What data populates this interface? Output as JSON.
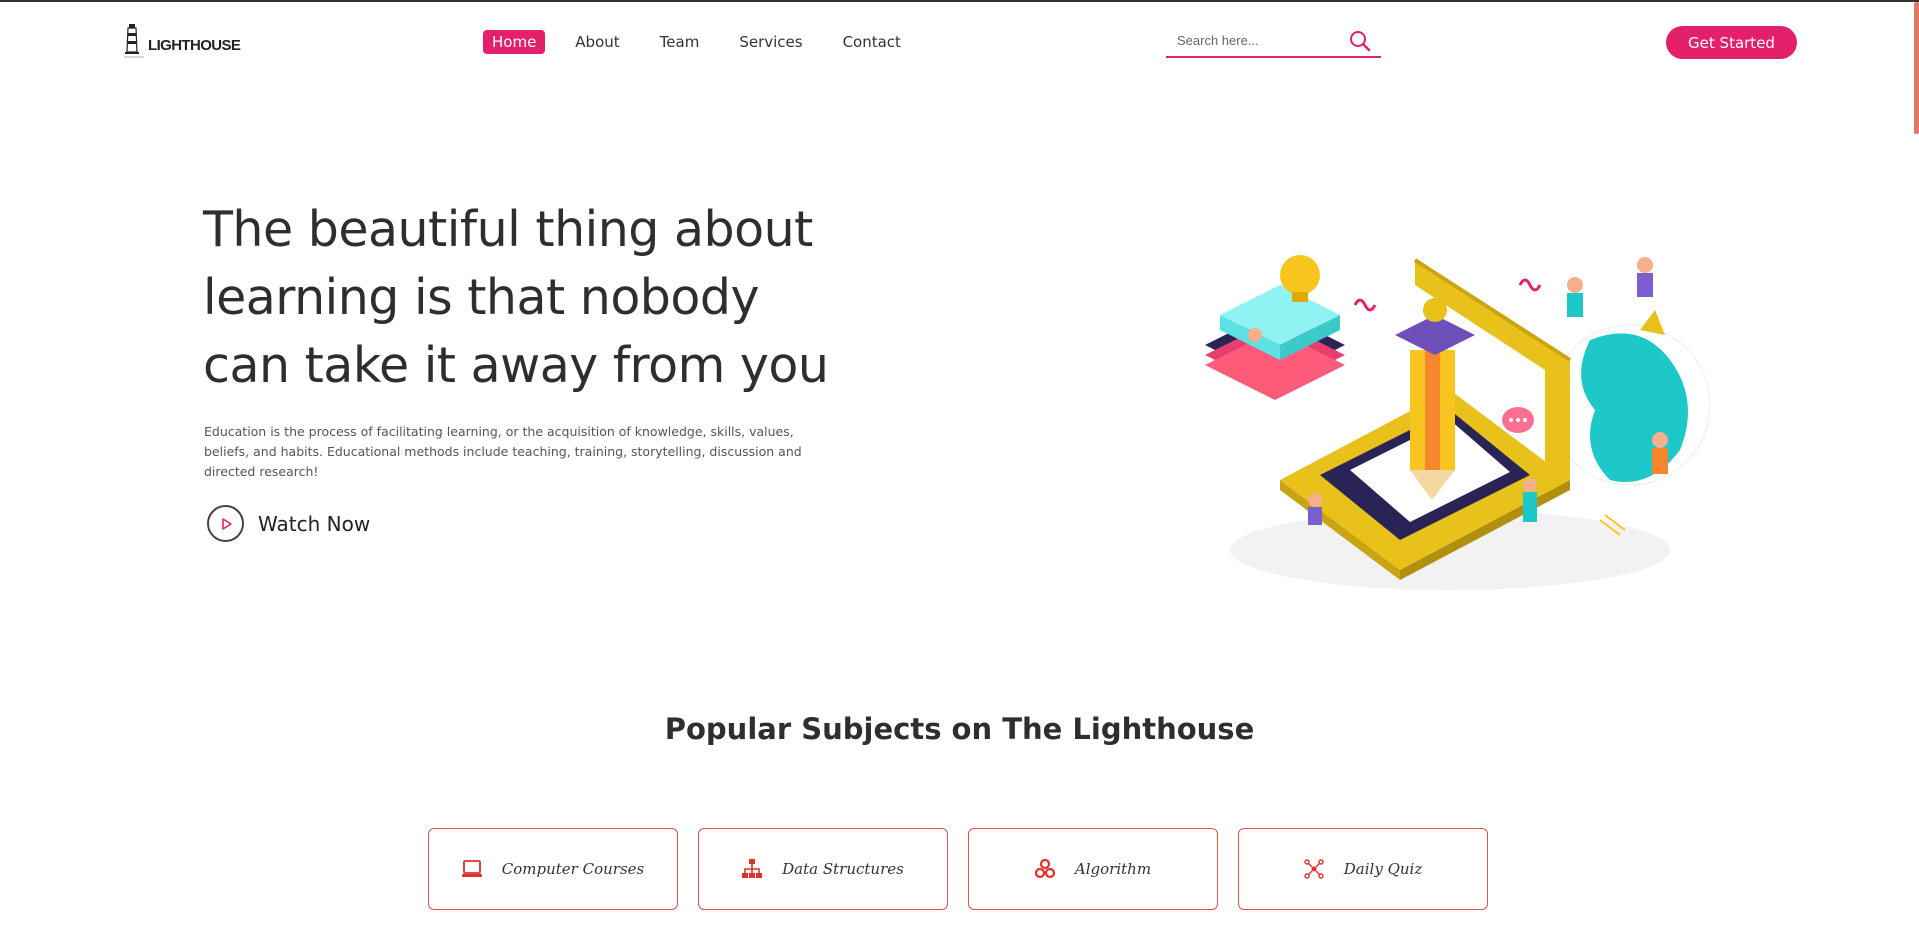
{
  "header": {
    "logo_text": "LIGHTHOUSE",
    "nav": [
      {
        "label": "Home",
        "active": true
      },
      {
        "label": "About",
        "active": false
      },
      {
        "label": "Team",
        "active": false
      },
      {
        "label": "Services",
        "active": false
      },
      {
        "label": "Contact",
        "active": false
      }
    ],
    "search_placeholder": "Search here...",
    "cta_label": "Get Started"
  },
  "hero": {
    "title": "The beautiful thing about learning is that nobody can take it away from you",
    "description": "Education is the process of facilitating learning, or the acquisition of knowledge, skills, values, beliefs, and habits. Educational methods include teaching, training, storytelling, discussion and directed research!",
    "watch_label": "Watch Now"
  },
  "subjects": {
    "title": "Popular Subjects on The Lighthouse",
    "items": [
      {
        "label": "Computer Courses",
        "icon": "laptop-icon"
      },
      {
        "label": "Data Structures",
        "icon": "sitemap-icon"
      },
      {
        "label": "Algorithm",
        "icon": "cogs-icon"
      },
      {
        "label": "Daily Quiz",
        "icon": "network-icon"
      }
    ]
  },
  "colors": {
    "accent": "#e4206b",
    "card_border": "#e8534a",
    "icon": "#e0302b"
  }
}
